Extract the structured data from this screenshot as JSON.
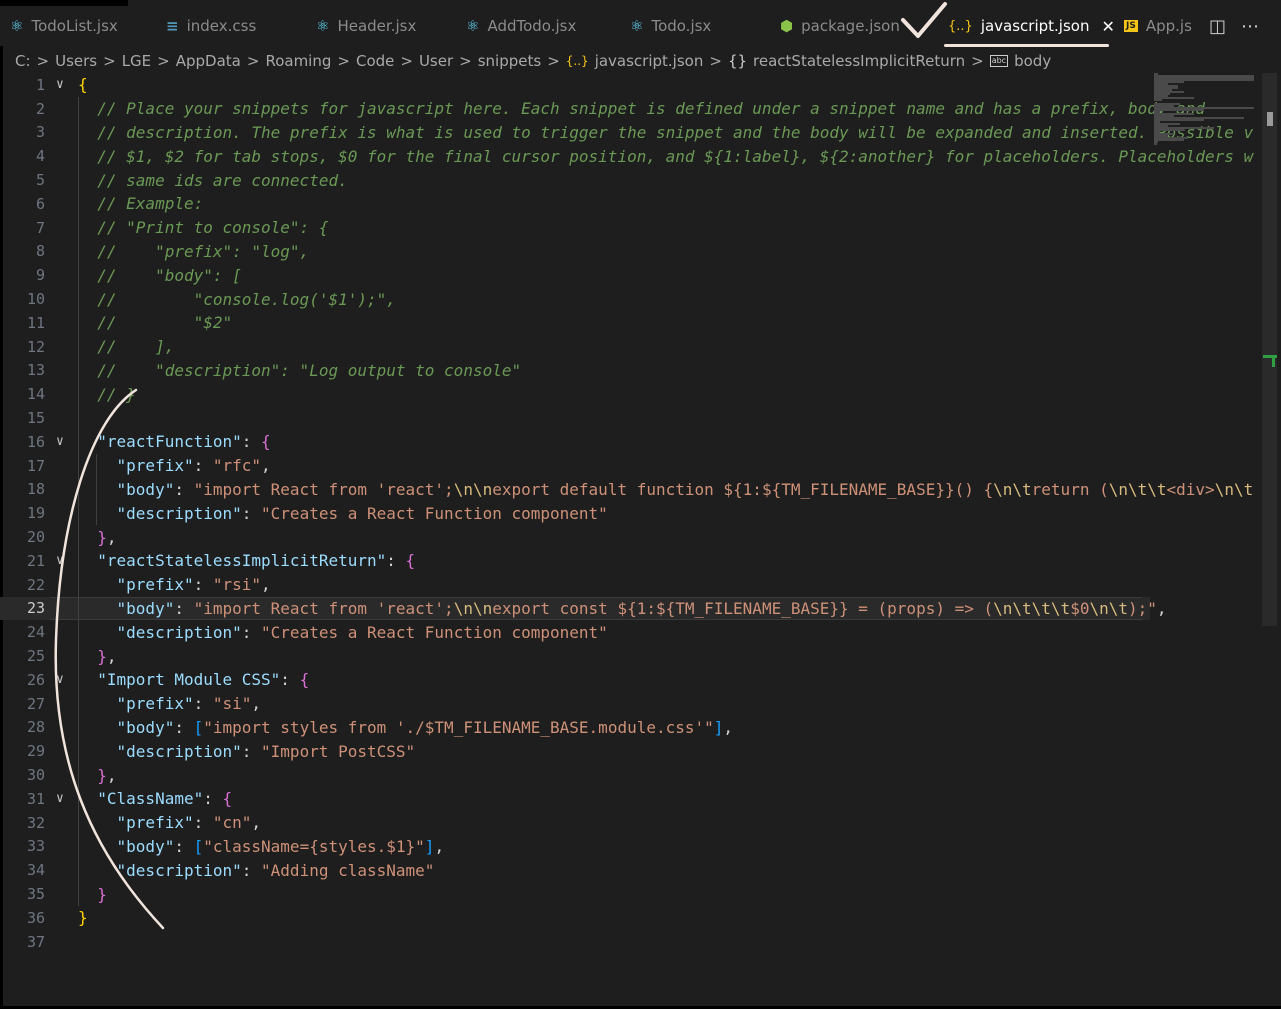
{
  "tabs": [
    {
      "label": "TodoList.jsx",
      "icon": "react-icon",
      "glyph": "⚛",
      "color": "#61dafb",
      "active": false
    },
    {
      "label": "index.css",
      "icon": "css-icon",
      "glyph": "≡",
      "color": "#519aba",
      "active": false
    },
    {
      "label": "Header.jsx",
      "icon": "react-icon",
      "glyph": "⚛",
      "color": "#61dafb",
      "active": false
    },
    {
      "label": "AddTodo.jsx",
      "icon": "react-icon",
      "glyph": "⚛",
      "color": "#61dafb",
      "active": false
    },
    {
      "label": "Todo.jsx",
      "icon": "react-icon",
      "glyph": "⚛",
      "color": "#61dafb",
      "active": false
    },
    {
      "label": "package.json",
      "icon": "nodejs-icon",
      "glyph": "⬢",
      "color": "#8bc34a",
      "active": false
    },
    {
      "label": "javascript.json",
      "icon": "json-braces-icon",
      "glyph": "{..}",
      "color": "#f5c518",
      "active": true
    },
    {
      "label": "App.js",
      "icon": "js-icon",
      "glyph": "JS",
      "color": "#f5c518",
      "active": false
    }
  ],
  "tab_close_glyph": "✕",
  "tab_actions": {
    "split_glyph": "◫",
    "more_glyph": "⋯"
  },
  "breadcrumb": {
    "items": [
      "C:",
      "Users",
      "LGE",
      "AppData",
      "Roaming",
      "Code",
      "User",
      "snippets"
    ],
    "file_icon": "{..}",
    "file": "javascript.json",
    "obj_icon": "{}",
    "obj": "reactStatelessImplicitReturn",
    "prop_icon": "abc",
    "prop": "body",
    "separator": ">"
  },
  "editor": {
    "current_line": 23,
    "lines": [
      {
        "n": "1",
        "fold": "∨",
        "tokens": [
          [
            "c-b1",
            "{"
          ]
        ]
      },
      {
        "n": "2",
        "tokens": [
          [
            "c-com",
            "  // Place your snippets for javascript here. Each snippet is defined under a snippet name and has a prefix, body and"
          ]
        ]
      },
      {
        "n": "3",
        "tokens": [
          [
            "c-com",
            "  // description. The prefix is what is used to trigger the snippet and the body will be expanded and inserted. Possible v"
          ]
        ]
      },
      {
        "n": "4",
        "tokens": [
          [
            "c-com",
            "  // $1, $2 for tab stops, $0 for the final cursor position, and ${1:label}, ${2:another} for placeholders. Placeholders w"
          ]
        ]
      },
      {
        "n": "5",
        "tokens": [
          [
            "c-com",
            "  // same ids are connected."
          ]
        ]
      },
      {
        "n": "6",
        "tokens": [
          [
            "c-com",
            "  // Example:"
          ]
        ]
      },
      {
        "n": "7",
        "tokens": [
          [
            "c-com",
            "  // \"Print to console\": {"
          ]
        ]
      },
      {
        "n": "8",
        "tokens": [
          [
            "c-com",
            "  //    \"prefix\": \"log\","
          ]
        ]
      },
      {
        "n": "9",
        "tokens": [
          [
            "c-com",
            "  //    \"body\": ["
          ]
        ]
      },
      {
        "n": "10",
        "tokens": [
          [
            "c-com",
            "  //        \"console.log('$1');\","
          ]
        ]
      },
      {
        "n": "11",
        "tokens": [
          [
            "c-com",
            "  //        \"$2\""
          ]
        ]
      },
      {
        "n": "12",
        "tokens": [
          [
            "c-com",
            "  //    ],"
          ]
        ]
      },
      {
        "n": "13",
        "tokens": [
          [
            "c-com",
            "  //    \"description\": \"Log output to console\""
          ]
        ]
      },
      {
        "n": "14",
        "tokens": [
          [
            "c-com",
            "  // }"
          ]
        ]
      },
      {
        "n": "15",
        "tokens": []
      },
      {
        "n": "16",
        "fold": "∨",
        "tokens": [
          [
            "c-punc",
            "  "
          ],
          [
            "c-key",
            "\"reactFunction\""
          ],
          [
            "c-punc",
            ": "
          ],
          [
            "c-b2",
            "{"
          ]
        ]
      },
      {
        "n": "17",
        "tokens": [
          [
            "c-punc",
            "    "
          ],
          [
            "c-key",
            "\"prefix\""
          ],
          [
            "c-punc",
            ": "
          ],
          [
            "c-str",
            "\"rfc\""
          ],
          [
            "c-punc",
            ","
          ]
        ]
      },
      {
        "n": "18",
        "tokens": [
          [
            "c-punc",
            "    "
          ],
          [
            "c-key",
            "\"body\""
          ],
          [
            "c-punc",
            ": "
          ],
          [
            "c-str",
            "\"import React from 'react';"
          ],
          [
            "c-esc",
            "\\n\\n"
          ],
          [
            "c-str",
            "export default function ${1:${TM_FILENAME_BASE}}() {"
          ],
          [
            "c-esc",
            "\\n\\t"
          ],
          [
            "c-str",
            "return ("
          ],
          [
            "c-esc",
            "\\n\\t\\t"
          ],
          [
            "c-str",
            "<div>"
          ],
          [
            "c-esc",
            "\\n\\t"
          ]
        ]
      },
      {
        "n": "19",
        "tokens": [
          [
            "c-punc",
            "    "
          ],
          [
            "c-key",
            "\"description\""
          ],
          [
            "c-punc",
            ": "
          ],
          [
            "c-str",
            "\"Creates a React Function component\""
          ]
        ]
      },
      {
        "n": "20",
        "tokens": [
          [
            "c-punc",
            "  "
          ],
          [
            "c-b2",
            "}"
          ],
          [
            "c-punc",
            ","
          ]
        ]
      },
      {
        "n": "21",
        "fold": "∨",
        "tokens": [
          [
            "c-punc",
            "  "
          ],
          [
            "c-key",
            "\"reactStatelessImplicitReturn\""
          ],
          [
            "c-punc",
            ": "
          ],
          [
            "c-b2",
            "{"
          ]
        ]
      },
      {
        "n": "22",
        "tokens": [
          [
            "c-punc",
            "    "
          ],
          [
            "c-key",
            "\"prefix\""
          ],
          [
            "c-punc",
            ": "
          ],
          [
            "c-str",
            "\"rsi\""
          ],
          [
            "c-punc",
            ","
          ]
        ]
      },
      {
        "n": "23",
        "tokens": [
          [
            "c-punc",
            "    "
          ],
          [
            "c-key",
            "\"body\""
          ],
          [
            "c-punc",
            ": "
          ],
          [
            "c-str",
            "\"import React from 'react';"
          ],
          [
            "c-esc",
            "\\n\\n"
          ],
          [
            "c-str",
            "export const ${1:${TM_FILENAME_BASE}} = (props) => ("
          ],
          [
            "c-esc",
            "\\n\\t\\t\\t"
          ],
          [
            "c-str",
            "$0"
          ],
          [
            "c-esc",
            "\\n\\t"
          ],
          [
            "c-str",
            ");\""
          ],
          [
            "c-punc",
            ","
          ]
        ]
      },
      {
        "n": "24",
        "tokens": [
          [
            "c-punc",
            "    "
          ],
          [
            "c-key",
            "\"description\""
          ],
          [
            "c-punc",
            ": "
          ],
          [
            "c-str",
            "\"Creates a React Function component\""
          ]
        ]
      },
      {
        "n": "25",
        "tokens": [
          [
            "c-punc",
            "  "
          ],
          [
            "c-b2",
            "}"
          ],
          [
            "c-punc",
            ","
          ]
        ]
      },
      {
        "n": "26",
        "fold": "∨",
        "tokens": [
          [
            "c-punc",
            "  "
          ],
          [
            "c-key",
            "\"Import Module CSS\""
          ],
          [
            "c-punc",
            ": "
          ],
          [
            "c-b2",
            "{"
          ]
        ]
      },
      {
        "n": "27",
        "tokens": [
          [
            "c-punc",
            "    "
          ],
          [
            "c-key",
            "\"prefix\""
          ],
          [
            "c-punc",
            ": "
          ],
          [
            "c-str",
            "\"si\""
          ],
          [
            "c-punc",
            ","
          ]
        ]
      },
      {
        "n": "28",
        "tokens": [
          [
            "c-punc",
            "    "
          ],
          [
            "c-key",
            "\"body\""
          ],
          [
            "c-punc",
            ": "
          ],
          [
            "c-b3",
            "["
          ],
          [
            "c-str",
            "\"import styles from './$TM_FILENAME_BASE.module.css'\""
          ],
          [
            "c-b3",
            "]"
          ],
          [
            "c-punc",
            ","
          ]
        ]
      },
      {
        "n": "29",
        "tokens": [
          [
            "c-punc",
            "    "
          ],
          [
            "c-key",
            "\"description\""
          ],
          [
            "c-punc",
            ": "
          ],
          [
            "c-str",
            "\"Import PostCSS\""
          ]
        ]
      },
      {
        "n": "30",
        "tokens": [
          [
            "c-punc",
            "  "
          ],
          [
            "c-b2",
            "}"
          ],
          [
            "c-punc",
            ","
          ]
        ]
      },
      {
        "n": "31",
        "fold": "∨",
        "tokens": [
          [
            "c-punc",
            "  "
          ],
          [
            "c-key",
            "\"ClassName\""
          ],
          [
            "c-punc",
            ": "
          ],
          [
            "c-b2",
            "{"
          ]
        ]
      },
      {
        "n": "32",
        "tokens": [
          [
            "c-punc",
            "    "
          ],
          [
            "c-key",
            "\"prefix\""
          ],
          [
            "c-punc",
            ": "
          ],
          [
            "c-str",
            "\"cn\""
          ],
          [
            "c-punc",
            ","
          ]
        ]
      },
      {
        "n": "33",
        "tokens": [
          [
            "c-punc",
            "    "
          ],
          [
            "c-key",
            "\"body\""
          ],
          [
            "c-punc",
            ": "
          ],
          [
            "c-b3",
            "["
          ],
          [
            "c-str",
            "\"className={styles.$1}\""
          ],
          [
            "c-b3",
            "]"
          ],
          [
            "c-punc",
            ","
          ]
        ]
      },
      {
        "n": "34",
        "tokens": [
          [
            "c-punc",
            "    "
          ],
          [
            "c-key",
            "\"description\""
          ],
          [
            "c-punc",
            ": "
          ],
          [
            "c-str",
            "\"Adding className\""
          ]
        ]
      },
      {
        "n": "35",
        "tokens": [
          [
            "c-punc",
            "  "
          ],
          [
            "c-b2",
            "}"
          ]
        ]
      },
      {
        "n": "36",
        "tokens": [
          [
            "c-b1",
            "}"
          ]
        ]
      },
      {
        "n": "37",
        "tokens": []
      }
    ]
  },
  "colors": {
    "editor_bg": "#1e1e1e",
    "comment": "#6a9955",
    "key": "#9cdcfe",
    "string": "#ce9178",
    "escape": "#d7ba7d",
    "annotation": "#f0e4dc"
  }
}
